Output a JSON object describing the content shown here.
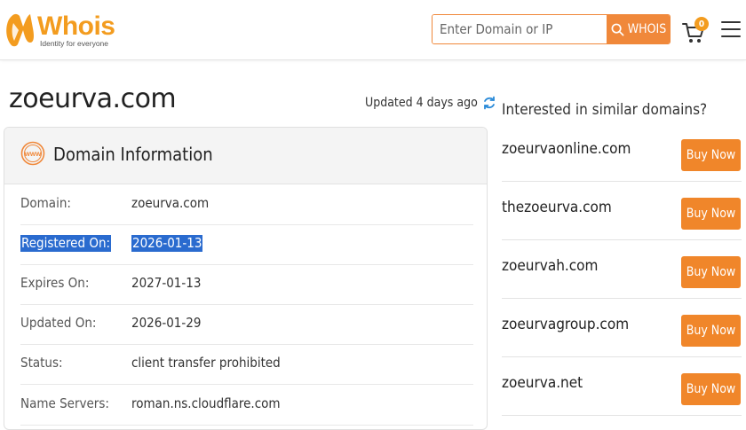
{
  "header": {
    "logo_text": "Whois",
    "logo_tagline": "Identity for everyone",
    "search_placeholder": "Enter Domain or IP",
    "search_button": "WHOIS",
    "cart_count": "0",
    "brand_color": "#f39c1f",
    "accent_color": "#f0883a"
  },
  "domain": {
    "name": "zoeurva.com",
    "updated_text": "Updated 4 days ago"
  },
  "domain_info": {
    "title": "Domain Information",
    "rows": [
      {
        "label": "Domain:",
        "value": "zoeurva.com"
      },
      {
        "label": "Registered On:",
        "value": "2026-01-13",
        "highlighted": true
      },
      {
        "label": "Expires On:",
        "value": "2027-01-13"
      },
      {
        "label": "Updated On:",
        "value": "2026-01-29"
      },
      {
        "label": "Status:",
        "value": "client transfer prohibited"
      },
      {
        "label": "Name Servers:",
        "value": "roman.ns.cloudflare.com"
      }
    ],
    "highlight_color": "#2a6bcf"
  },
  "similar": {
    "title": "Interested in similar domains?",
    "button_label": "Buy Now",
    "domains": [
      {
        "name": "zoeurvaonline.com",
        "button": "Buy Now"
      },
      {
        "name": "thezoeurva.com",
        "button": "Buy Now"
      },
      {
        "name": "zoeurvah.com",
        "button": "Buy Now"
      },
      {
        "name": "zoeurvagroup.com",
        "button": "Buy Now"
      },
      {
        "name": "zoeurva.net",
        "button": "Buy Now"
      }
    ]
  },
  "icons": [
    "whois-logo-icon",
    "search-icon",
    "cart-icon",
    "menu-icon",
    "refresh-icon",
    "www-icon"
  ]
}
